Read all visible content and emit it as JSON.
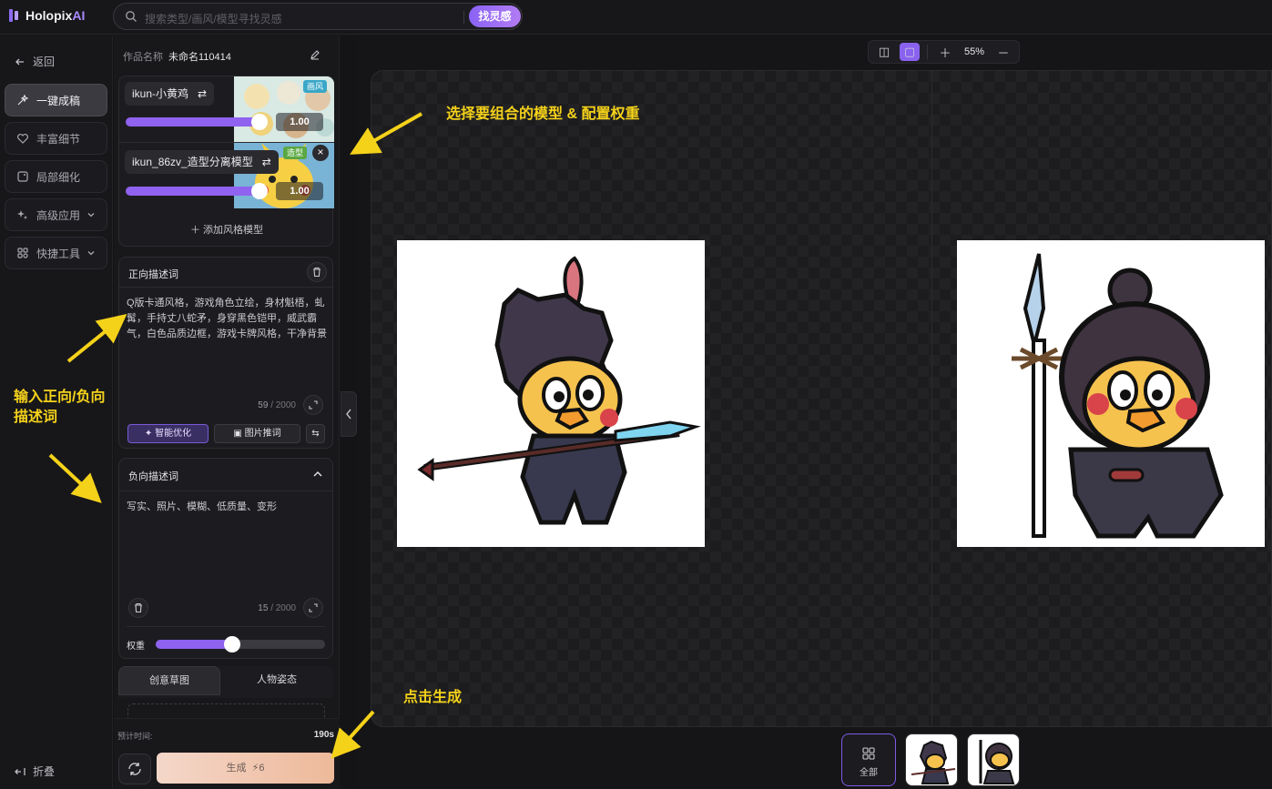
{
  "app": {
    "logo_main": "Holopix",
    "logo_ai": "AI"
  },
  "search": {
    "placeholder": "搜索类型/画风/模型寻找灵感",
    "button": "找灵感"
  },
  "nav": {
    "back": "返回",
    "items": [
      "一键成稿",
      "丰富细节",
      "局部细化",
      "高级应用",
      "快捷工具"
    ],
    "fold": "折叠"
  },
  "work": {
    "label": "作品名称",
    "name": "未命名110414"
  },
  "models": [
    {
      "name": "ikun-小黄鸡",
      "weight": "1.00",
      "tag": "画风",
      "tag_color": "#3aa7c8"
    },
    {
      "name": "ikun_86zv_造型分离模型",
      "weight": "1.00",
      "tag": "造型",
      "tag_color": "#5aa843"
    }
  ],
  "add_model": "添加风格模型",
  "positive": {
    "title": "正向描述词",
    "text": "Q版卡通风格，游戏角色立绘，身材魁梧，虬髯，手持丈八蛇矛，身穿黑色铠甲，威武霸气，白色品质边框，游戏卡牌风格，干净背景",
    "count": "59",
    "max": "/ 2000",
    "btn_optimize": "智能优化",
    "btn_image": "图片推词"
  },
  "negative": {
    "title": "负向描述词",
    "text": "写实、照片、模糊、低质量、变形",
    "count": "15",
    "max": "/ 2000",
    "weight_label": "权重",
    "weight": 0.45
  },
  "tabs": [
    "创意草图",
    "人物姿态"
  ],
  "footer": {
    "est_label": "预计时间:",
    "est_value": "190s",
    "generate": "生成",
    "cost": "6"
  },
  "toolbar": {
    "zoom": "55%"
  },
  "gallery": {
    "all": "全部"
  },
  "annotations": {
    "models": "选择要组合的模型 & 配置权重",
    "prompt": "输入正向/负向\n描述词",
    "generate": "点击生成"
  },
  "colors": {
    "accent": "#8a62f0",
    "annotation": "#f5d21a"
  }
}
